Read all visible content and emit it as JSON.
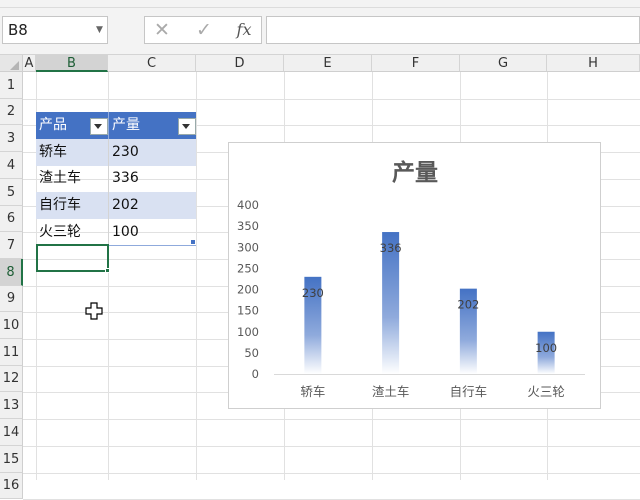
{
  "formula_bar": {
    "name_box": "B8",
    "cancel_icon": "✕",
    "enter_icon": "✓",
    "function_icon": "fx",
    "formula": ""
  },
  "columns": [
    "A",
    "B",
    "C",
    "D",
    "E",
    "F",
    "G",
    "H"
  ],
  "rows": [
    "1",
    "2",
    "3",
    "4",
    "5",
    "6",
    "7",
    "8",
    "9",
    "10",
    "11",
    "12",
    "13",
    "14",
    "15",
    "16"
  ],
  "table": {
    "headers": [
      "产品",
      "产量"
    ],
    "rows": [
      [
        "轿车",
        "230"
      ],
      [
        "渣土车",
        "336"
      ],
      [
        "自行车",
        "202"
      ],
      [
        "火三轮",
        "100"
      ]
    ]
  },
  "chart_data": {
    "type": "bar",
    "title": "产量",
    "categories": [
      "轿车",
      "渣土车",
      "自行车",
      "火三轮"
    ],
    "values": [
      230,
      336,
      202,
      100
    ],
    "ylim": [
      0,
      400
    ],
    "yticks": [
      0,
      50,
      100,
      150,
      200,
      250,
      300,
      350,
      400
    ],
    "grid": false,
    "legend": "none",
    "data_labels": true,
    "bar_color": "#4472c4"
  }
}
